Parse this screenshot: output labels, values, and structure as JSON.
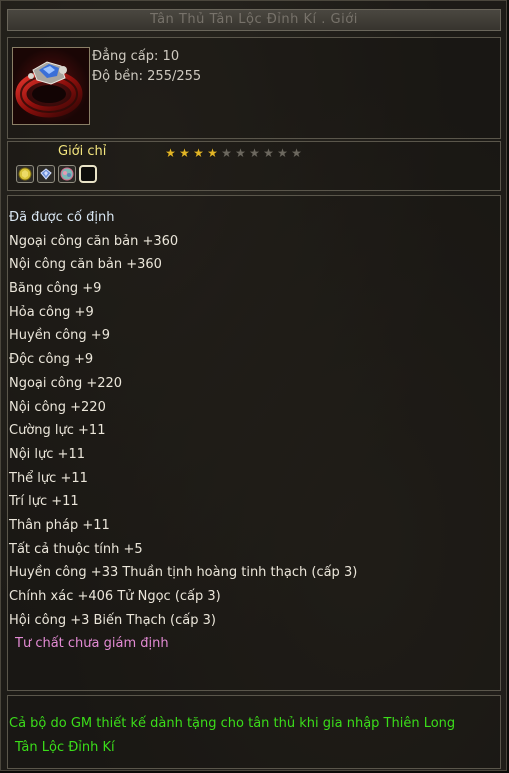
{
  "title": "Tân Thủ Tân Lộc Đỉnh Kí . Giới",
  "item": {
    "icon": "ring-icon",
    "level": "Đẳng cấp: 10",
    "durability": "Độ bền: 255/255"
  },
  "rank": {
    "type_label": "Giới chỉ",
    "stars_filled": 4,
    "stars_total": 10,
    "colors": {
      "star_on": "#e2b526",
      "star_off": "#6c685f"
    },
    "gem_slots": [
      {
        "icon": "yellow-gem-icon",
        "color": "#d9c43a"
      },
      {
        "icon": "blue-gem-icon",
        "color": "#6c8fd6"
      },
      {
        "icon": "teal-gem-icon",
        "color": "#7fb9b6"
      },
      {
        "icon": "empty-slot-icon",
        "color": "#0e0d0b"
      }
    ]
  },
  "attributes": [
    {
      "text": "Đã được cố định",
      "kind": "fixed"
    },
    {
      "text": "Ngoại công căn bản +360",
      "kind": "stat"
    },
    {
      "text": "Nội công căn bản +360",
      "kind": "stat"
    },
    {
      "text": "Băng công +9",
      "kind": "stat"
    },
    {
      "text": "Hỏa công +9",
      "kind": "stat"
    },
    {
      "text": "Huyền công +9",
      "kind": "stat"
    },
    {
      "text": "Độc công +9",
      "kind": "stat"
    },
    {
      "text": "Ngoại công +220",
      "kind": "stat"
    },
    {
      "text": "Nội công +220",
      "kind": "stat"
    },
    {
      "text": "Cường lực +11",
      "kind": "stat"
    },
    {
      "text": "Nội lực +11",
      "kind": "stat"
    },
    {
      "text": "Thể lực +11",
      "kind": "stat"
    },
    {
      "text": "Trí lực +11",
      "kind": "stat"
    },
    {
      "text": "Thân pháp +11",
      "kind": "stat"
    },
    {
      "text": "Tất cả thuộc tính +5",
      "kind": "stat"
    },
    {
      "text": "Huyền công +33 Thuần tịnh hoàng tinh thạch (cấp 3)",
      "kind": "gem"
    },
    {
      "text": "Chính xác +406 Tử Ngọc (cấp 3)",
      "kind": "gem"
    },
    {
      "text": "Hội công +3 Biến Thạch (cấp 3)",
      "kind": "gem"
    },
    {
      "text": "Tư chất chưa giám định",
      "kind": "unidentified"
    }
  ],
  "description": {
    "line1": "Cả bộ do GM thiết kế dành tặng cho tân thủ khi gia nhập Thiên Long",
    "line2": "Tân Lộc Đỉnh Kí"
  },
  "colors": {
    "title_text": "#77726a",
    "attribute_text": "#ebe6da",
    "unidentified_text": "#e38bd4",
    "description_text": "#3bdd1a",
    "type_label": "#f3e57e"
  }
}
